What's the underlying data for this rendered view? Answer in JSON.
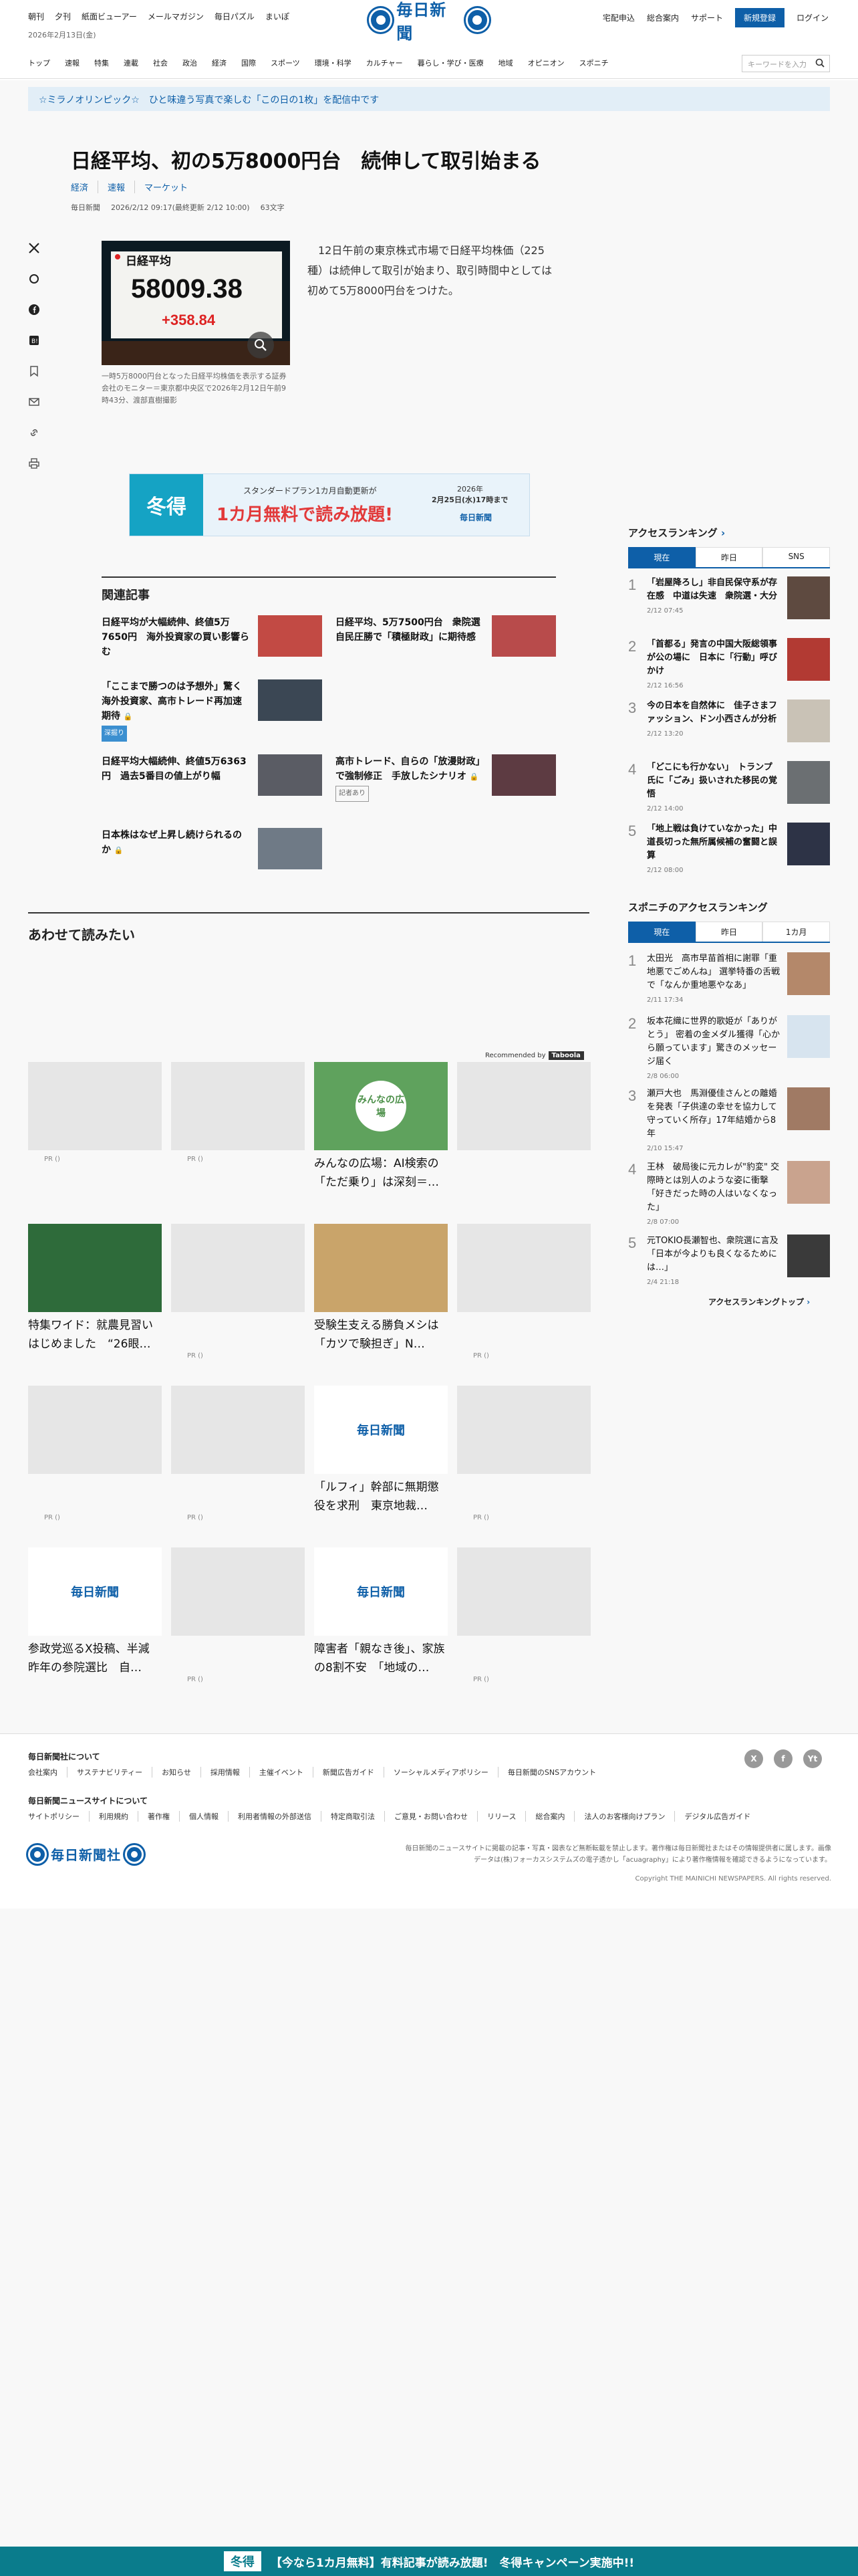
{
  "header": {
    "top_links": [
      "朝刊",
      "夕刊",
      "紙面ビューアー",
      "メールマガジン",
      "毎日パズル",
      "まいぽ"
    ],
    "date": "2026年2月13日(金)",
    "logo": "毎日新聞",
    "right_links": [
      "宅配申込",
      "総合案内",
      "サポート"
    ],
    "register": "新規登録",
    "login": "ログイン",
    "categories": [
      "トップ",
      "速報",
      "特集",
      "連載",
      "社会",
      "政治",
      "経済",
      "国際",
      "スポーツ",
      "環境・科学",
      "カルチャー",
      "暮らし・学び・医療",
      "地域",
      "オピニオン",
      "スポニチ"
    ],
    "search_placeholder": "キーワードを入力"
  },
  "banner": "☆ミラノオリンピック☆　ひと味違う写真で楽しむ「この日の1枚」を配信中です",
  "article": {
    "title": "日経平均、初の5万8000円台　続伸して取引始まる",
    "tags": [
      "経済",
      "速報",
      "マーケット"
    ],
    "source": "毎日新聞",
    "dates": "2026/2/12 09:17(最終更新 2/12 10:00)",
    "chars": "63文字",
    "photo_label": "日経平均",
    "photo_value": "58009.38",
    "photo_change": "+358.84",
    "caption": "一時5万8000円台となった日経平均株価を表示する証券会社のモニター＝東京都中央区で2026年2月12日午前9時43分、渡部直樹撮影",
    "lead": "12日午前の東京株式市場で日経平均株価（225種）は続伸して取引が始まり、取引時間中としては初めて5万8000円台をつけた。"
  },
  "ad": {
    "badge": "冬得",
    "line1": "スタンダードプラン1カ月自動更新が",
    "line2": "1カ月無料で読み放題!",
    "period_year": "2026年",
    "period": "2月25日(水)17時まで",
    "brand": "毎日新聞"
  },
  "related": {
    "heading": "関連記事",
    "items": [
      {
        "title": "日経平均が大幅続伸、終値5万7650円　海外投資家の買い影響らむ"
      },
      {
        "title": "日経平均、5万7500円台　衆院選自民圧勝で「積極財政」に期待感"
      },
      {
        "title": "「ここまで勝つのは予想外」驚く海外投資家、高市トレード再加速期待",
        "badge": "深掘り"
      },
      {
        "title": "日経平均大幅続伸、終値5万6363円　過去5番目の値上がり幅"
      },
      {
        "title": "高市トレード、自らの「放漫財政」で強制修正　手放したシナリオ",
        "badge": "記者あり"
      },
      {
        "title": "日本株はなぜ上昇し続けられるのか"
      }
    ]
  },
  "also": {
    "heading": "あわせて読みたい",
    "recommended": "Recommended by",
    "reco_brand": "Taboola",
    "cards": [
      {
        "title": "",
        "pr": "PR ()"
      },
      {
        "title": "",
        "pr": "PR ()"
      },
      {
        "title": "みんなの広場：AI検索の「ただ乗り」は深刻＝…",
        "pr": "",
        "img_text": "みんなの広場"
      },
      {
        "title": "",
        "pr": ""
      },
      {
        "title": "特集ワイド：就農見習いはじめました　“26眼…",
        "pr": ""
      },
      {
        "title": "",
        "pr": "PR ()"
      },
      {
        "title": "受験生支える勝負メシは　「カツで験担ぎ」N…",
        "pr": ""
      },
      {
        "title": "",
        "pr": "PR ()"
      },
      {
        "title": "",
        "pr": "PR ()"
      },
      {
        "title": "",
        "pr": "PR ()"
      },
      {
        "title": "「ルフィ」幹部に無期懲役を求刑　東京地裁…",
        "pr": "",
        "img_text": "毎日新聞"
      },
      {
        "title": "",
        "pr": "PR ()"
      },
      {
        "title": "参政党巡るX投稿、半減　昨年の参院選比　自…",
        "pr": "",
        "img_text": "毎日新聞"
      },
      {
        "title": "",
        "pr": "PR ()"
      },
      {
        "title": "障害者「親なき後」、家族の8割不安　「地域の…",
        "pr": "",
        "img_text": "毎日新聞"
      },
      {
        "title": "",
        "pr": "PR ()"
      }
    ]
  },
  "ranking": {
    "heading": "アクセスランキング",
    "tabs": [
      "現在",
      "昨日",
      "SNS"
    ],
    "items": [
      {
        "rank": "1",
        "title": "「岩屋降ろし」非自民保守系が存在感　中道は失速　衆院選・大分",
        "time": "2/12 07:45"
      },
      {
        "rank": "2",
        "title": "「首都る」発言の中国大阪総領事が公の場に　日本に「行動」呼びかけ",
        "time": "2/12 16:56"
      },
      {
        "rank": "3",
        "title": "今の日本を自然体に　佳子さまファッション、ドン小西さんが分析",
        "time": "2/12 13:20"
      },
      {
        "rank": "4",
        "title": "「どこにも行かない」　トランプ氏に「ごみ」扱いされた移民の覚悟",
        "time": "2/12 14:00"
      },
      {
        "rank": "5",
        "title": "「地上戦は負けていなかった」中道長切った無所属候補の奮闘と誤算",
        "time": "2/12 08:00"
      }
    ]
  },
  "sponichi": {
    "heading": "スポニチのアクセスランキング",
    "tabs": [
      "現在",
      "昨日",
      "1カ月"
    ],
    "items": [
      {
        "rank": "1",
        "title": "太田光　高市早苗首相に謝罪「重地悪でごめんね」 選挙特番の舌戦で「なんか重地悪やなあ」",
        "time": "2/11 17:34"
      },
      {
        "rank": "2",
        "title": "坂本花織に世界的歌姫が「ありがとう」 密着の金メダル獲得「心から願っています」驚きのメッセージ届く",
        "time": "2/8 06:00"
      },
      {
        "rank": "3",
        "title": "瀬戸大也　馬淵優佳さんとの離婚を発表「子供達の幸せを協力して守っていく所存」17年結婚から8年",
        "time": "2/10 15:47"
      },
      {
        "rank": "4",
        "title": "王林　破局後に元カレが\"豹変\" 交際時とは別人のような姿に衝撃「好きだった時の人はいなくなった」",
        "time": "2/8 07:00"
      },
      {
        "rank": "5",
        "title": "元TOKIO長瀬智也、衆院選に言及「日本が今よりも良くなるためには…」",
        "time": "2/4 21:18"
      }
    ],
    "top_link": "アクセスランキングトップ"
  },
  "footer": {
    "about": "毎日新聞社について",
    "about_links": [
      "会社案内",
      "サステナビリティー",
      "お知らせ",
      "採用情報",
      "主催イベント",
      "新聞広告ガイド",
      "ソーシャルメディアポリシー",
      "毎日新聞のSNSアカウント"
    ],
    "site": "毎日新聞ニュースサイトについて",
    "site_links": [
      "サイトポリシー",
      "利用規約",
      "著作権",
      "個人情報",
      "利用者情報の外部送信",
      "特定商取引法",
      "ご意見・お問い合わせ",
      "リリース",
      "総合案内",
      "法人のお客様向けプラン",
      "デジタル広告ガイド"
    ],
    "social": [
      "X",
      "f",
      "Yt"
    ],
    "logo": "毎日新聞社",
    "note": "毎日新聞のニュースサイトに掲載の記事・写真・図表など無断転載を禁止します。著作権は毎日新聞社またはその情報提供者に属します。画像データは(株)フォーカスシステムズの電子透かし「acuagraphy」により著作権情報を確認できるようになっています。",
    "copyright": "Copyright THE MAINICHI NEWSPAPERS. All rights reserved."
  },
  "bottom_bar": {
    "badge": "冬得",
    "text": "【今なら1カ月無料】有料記事が読み放題!　冬得キャンペーン実施中!!"
  },
  "colors": {
    "brand": "#0e5fa8",
    "bottom_bar": "#0a7c8c"
  }
}
